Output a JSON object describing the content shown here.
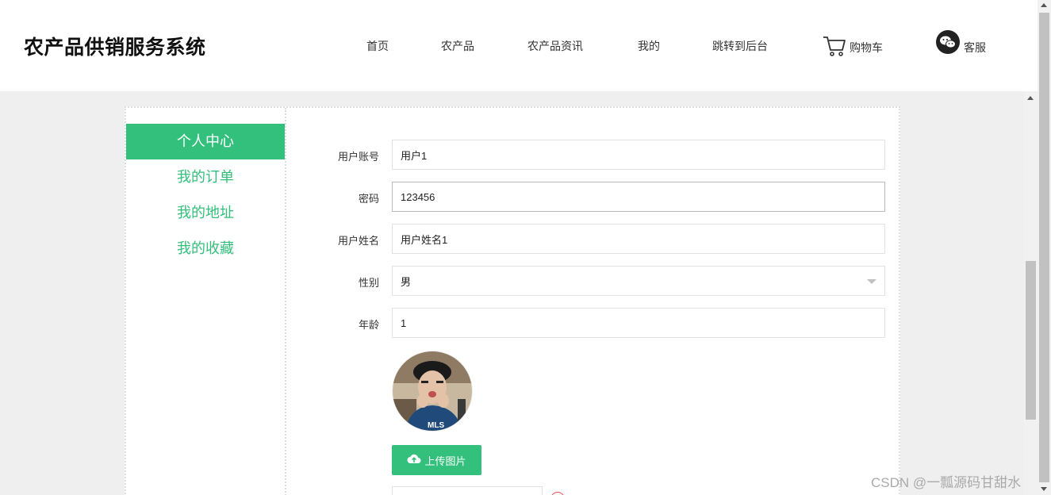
{
  "header": {
    "brand": "农产品供销服务系统",
    "nav": [
      "首页",
      "农产品",
      "农产品资讯",
      "我的",
      "跳转到后台"
    ],
    "cart_label": "购物车",
    "service_label": "客服"
  },
  "sidebar": {
    "items": [
      {
        "label": "个人中心",
        "active": true
      },
      {
        "label": "我的订单",
        "active": false
      },
      {
        "label": "我的地址",
        "active": false
      },
      {
        "label": "我的收藏",
        "active": false
      }
    ]
  },
  "form": {
    "fields": [
      {
        "label": "用户账号",
        "value": "用户1"
      },
      {
        "label": "密码",
        "value": "123456"
      },
      {
        "label": "用户姓名",
        "value": "用户姓名1"
      },
      {
        "label": "性别",
        "value": "男"
      },
      {
        "label": "年龄",
        "value": "1"
      }
    ],
    "upload_label": "上传图片"
  },
  "watermark": "CSDN @一瓢源码甘甜水",
  "colors": {
    "accent": "#33c07c",
    "accent_text": "#33bf7b"
  },
  "icons": {
    "cart": "cart-icon",
    "service": "wechat-icon",
    "upload": "cloud-upload-icon"
  }
}
